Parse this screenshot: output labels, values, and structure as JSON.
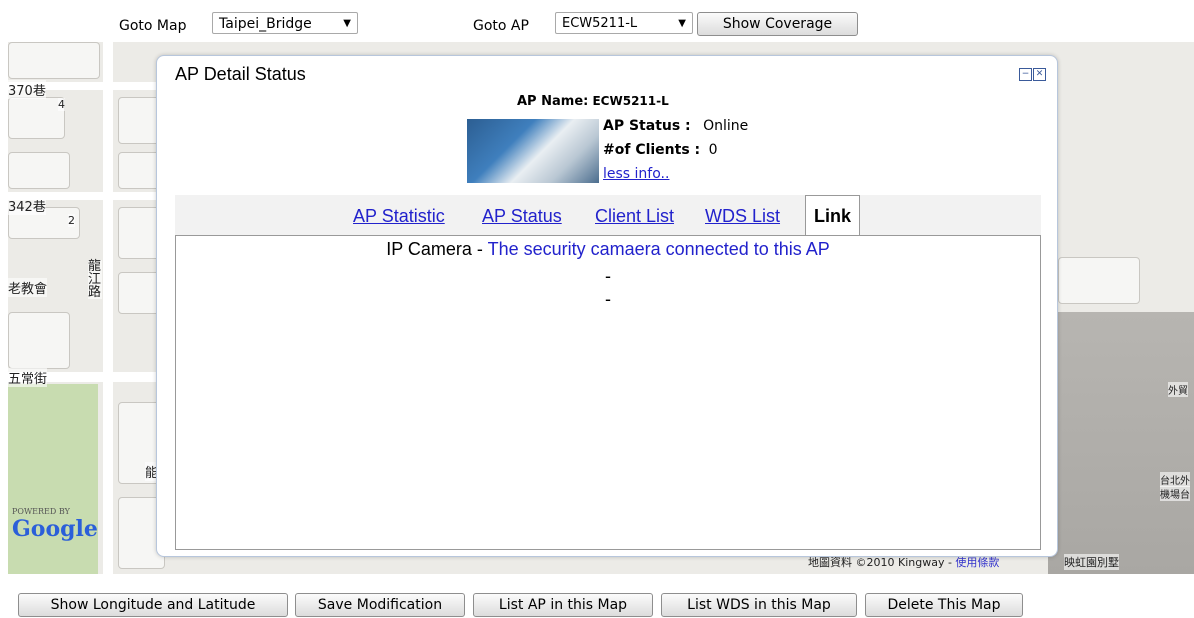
{
  "topbar": {
    "goto_map_label": "Goto Map",
    "map_selected": "Taipei_Bridge",
    "goto_ap_label": "Goto AP",
    "ap_selected": "ECW5211-L",
    "show_coverage": "Show Coverage"
  },
  "map": {
    "labels": [
      "370巷",
      "342巷",
      "老教會",
      "龍江路",
      "五常街",
      "能",
      "外貿",
      "台北外",
      "機場台",
      "映虹園別墅",
      "2",
      "4"
    ],
    "powered_by": "POWERED BY",
    "google": "Google",
    "copyright": "地圖資料 ©2010 Kingway - ",
    "terms": "使用條款"
  },
  "dialog": {
    "title": "AP Detail Status",
    "ap_name_label": "AP Name:",
    "ap_name": "ECW5211-L",
    "ap_status_label": "AP Status :",
    "ap_status": "Online",
    "clients_label": "#of Clients :",
    "clients": "0",
    "less_info": "less info..",
    "tabs": [
      "AP Statistic",
      "AP Status",
      "Client List",
      "WDS List",
      "Link"
    ],
    "active_tab": "Link",
    "link_prefix": "IP Camera - ",
    "link_text": "The security camaera connected to this AP",
    "dash1": "-",
    "dash2": "-"
  },
  "bottom": {
    "buttons": [
      "Show Longitude and Latitude",
      "Save Modification",
      "List AP in this Map",
      "List WDS in this Map",
      "Delete This Map"
    ]
  },
  "colors": {
    "link": "#2222cc",
    "map_bg": "#ecebe7",
    "park": "#c8dcb0",
    "dialog_border": "#b7c6dc"
  }
}
